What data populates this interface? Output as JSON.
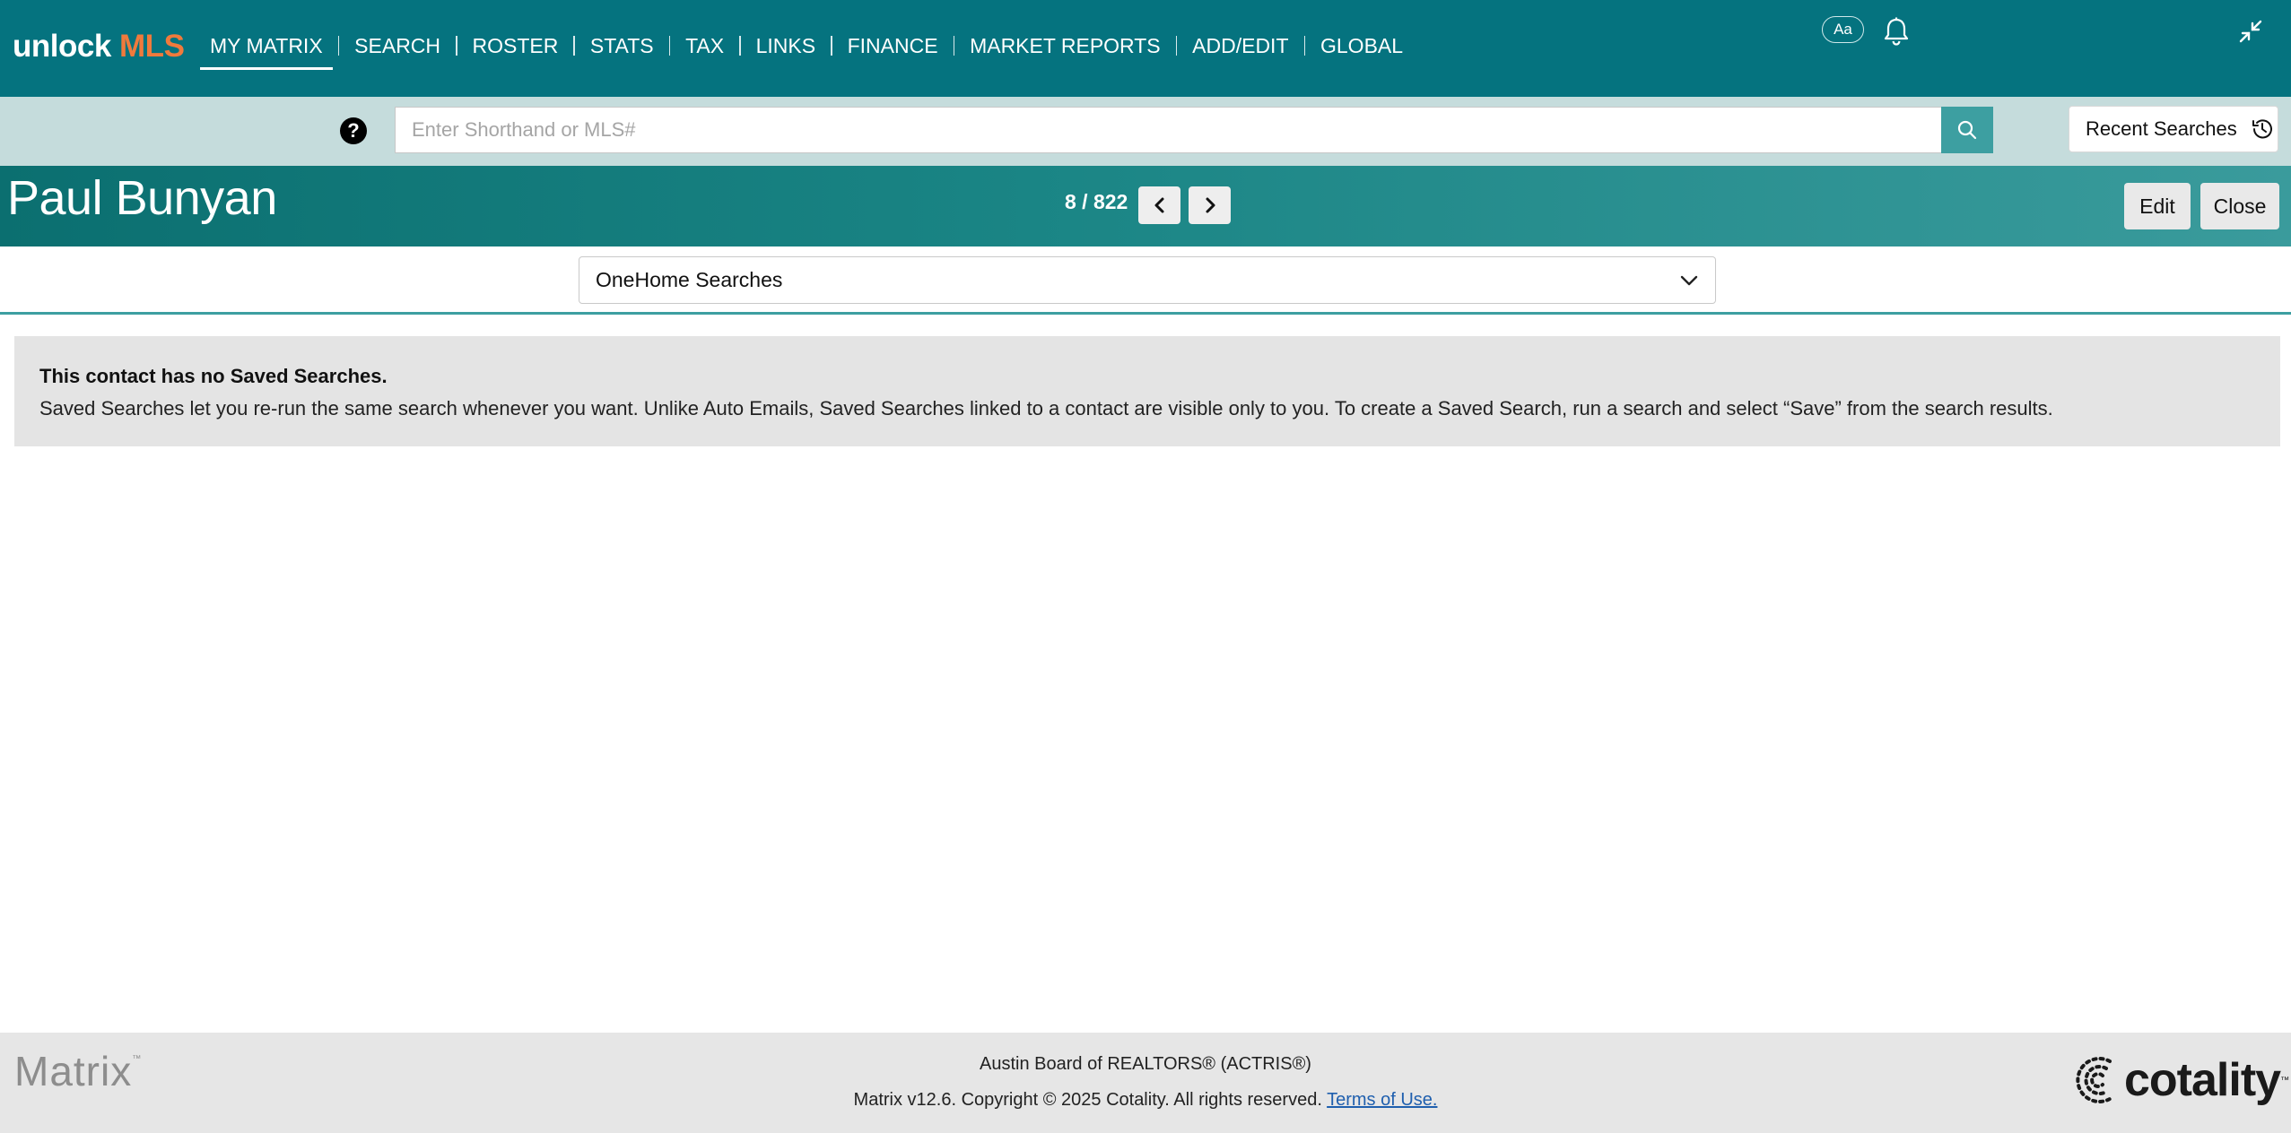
{
  "brand": {
    "logo_part1": "unlock",
    "logo_part2": "MLS",
    "accent": "#f07a3c",
    "nav_bg": "#05737f"
  },
  "nav": {
    "items": [
      "MY MATRIX",
      "SEARCH",
      "ROSTER",
      "STATS",
      "TAX",
      "LINKS",
      "FINANCE",
      "MARKET REPORTS",
      "ADD/EDIT",
      "GLOBAL"
    ],
    "active": "MY MATRIX",
    "font_size_label": "Aa"
  },
  "search": {
    "placeholder": "Enter Shorthand or MLS#",
    "value": "",
    "recent_label": "Recent Searches"
  },
  "contact": {
    "name": "Paul Bunyan",
    "position": "8 / 822",
    "edit_label": "Edit",
    "close_label": "Close"
  },
  "view_select": {
    "selected": "OneHome Searches"
  },
  "message": {
    "title": "This contact has no Saved Searches.",
    "body": "Saved Searches let you re-run the same search whenever you want. Unlike Auto Emails, Saved Searches linked to a contact are visible only to you. To create a Saved Search, run a search and select “Save” from the search results."
  },
  "footer": {
    "matrix_logo": "Matrix",
    "matrix_tm": "™",
    "board": "Austin Board of REALTORS® (ACTRIS®)",
    "copyright": "Matrix v12.6. Copyright © 2025 Cotality. All rights reserved.",
    "terms_link": "Terms of Use.",
    "cotality_logo": "cotality",
    "cotality_tm": "™"
  }
}
